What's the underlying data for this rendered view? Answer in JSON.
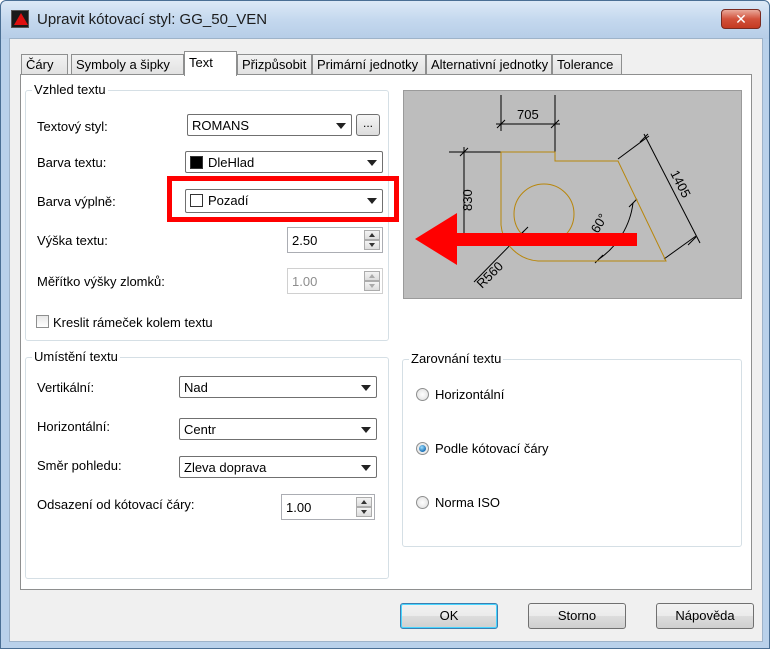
{
  "window": {
    "title": "Upravit kótovací styl: GG_50_VEN",
    "close_label": "✕"
  },
  "tabs": [
    "Čáry",
    "Symboly a šipky",
    "Text",
    "Přizpůsobit",
    "Primární jednotky",
    "Alternativní jednotky",
    "Tolerance"
  ],
  "active_tab": "Text",
  "text_appearance": {
    "title": "Vzhled textu",
    "text_style": {
      "label": "Textový styl:",
      "value": "ROMANS",
      "browse": "..."
    },
    "text_color": {
      "label": "Barva textu:",
      "value": "DleHlad",
      "swatch": "#000000"
    },
    "fill_color": {
      "label": "Barva výplně:",
      "value": "Pozadí",
      "swatch": "#ffffff"
    },
    "text_height": {
      "label": "Výška textu:",
      "value": "2.50"
    },
    "fraction_scale": {
      "label": "Měřítko výšky zlomků:",
      "value": "1.00"
    },
    "draw_frame": {
      "label": "Kreslit rámeček kolem textu",
      "checked": false
    }
  },
  "text_placement": {
    "title": "Umístění textu",
    "vertical": {
      "label": "Vertikální:",
      "value": "Nad"
    },
    "horizontal": {
      "label": "Horizontální:",
      "value": "Centr"
    },
    "view_direction": {
      "label": "Směr pohledu:",
      "value": "Zleva doprava"
    },
    "offset": {
      "label": "Odsazení od kótovací čáry:",
      "value": "1.00"
    }
  },
  "text_alignment": {
    "title": "Zarovnání textu",
    "options": [
      "Horizontální",
      "Podle kótovací čáry",
      "Norma ISO"
    ],
    "selected": "Podle kótovací čáry"
  },
  "preview": {
    "dim_top": "705",
    "dim_left": "830",
    "dim_diag": "1405",
    "angle": "60°",
    "radius": "R560"
  },
  "buttons": {
    "ok": "OK",
    "cancel": "Storno",
    "help": "Nápověda"
  },
  "colors": {
    "highlight": "#ff0000",
    "preview_bg": "#bdbdbd",
    "geometry": "#b8860b"
  }
}
